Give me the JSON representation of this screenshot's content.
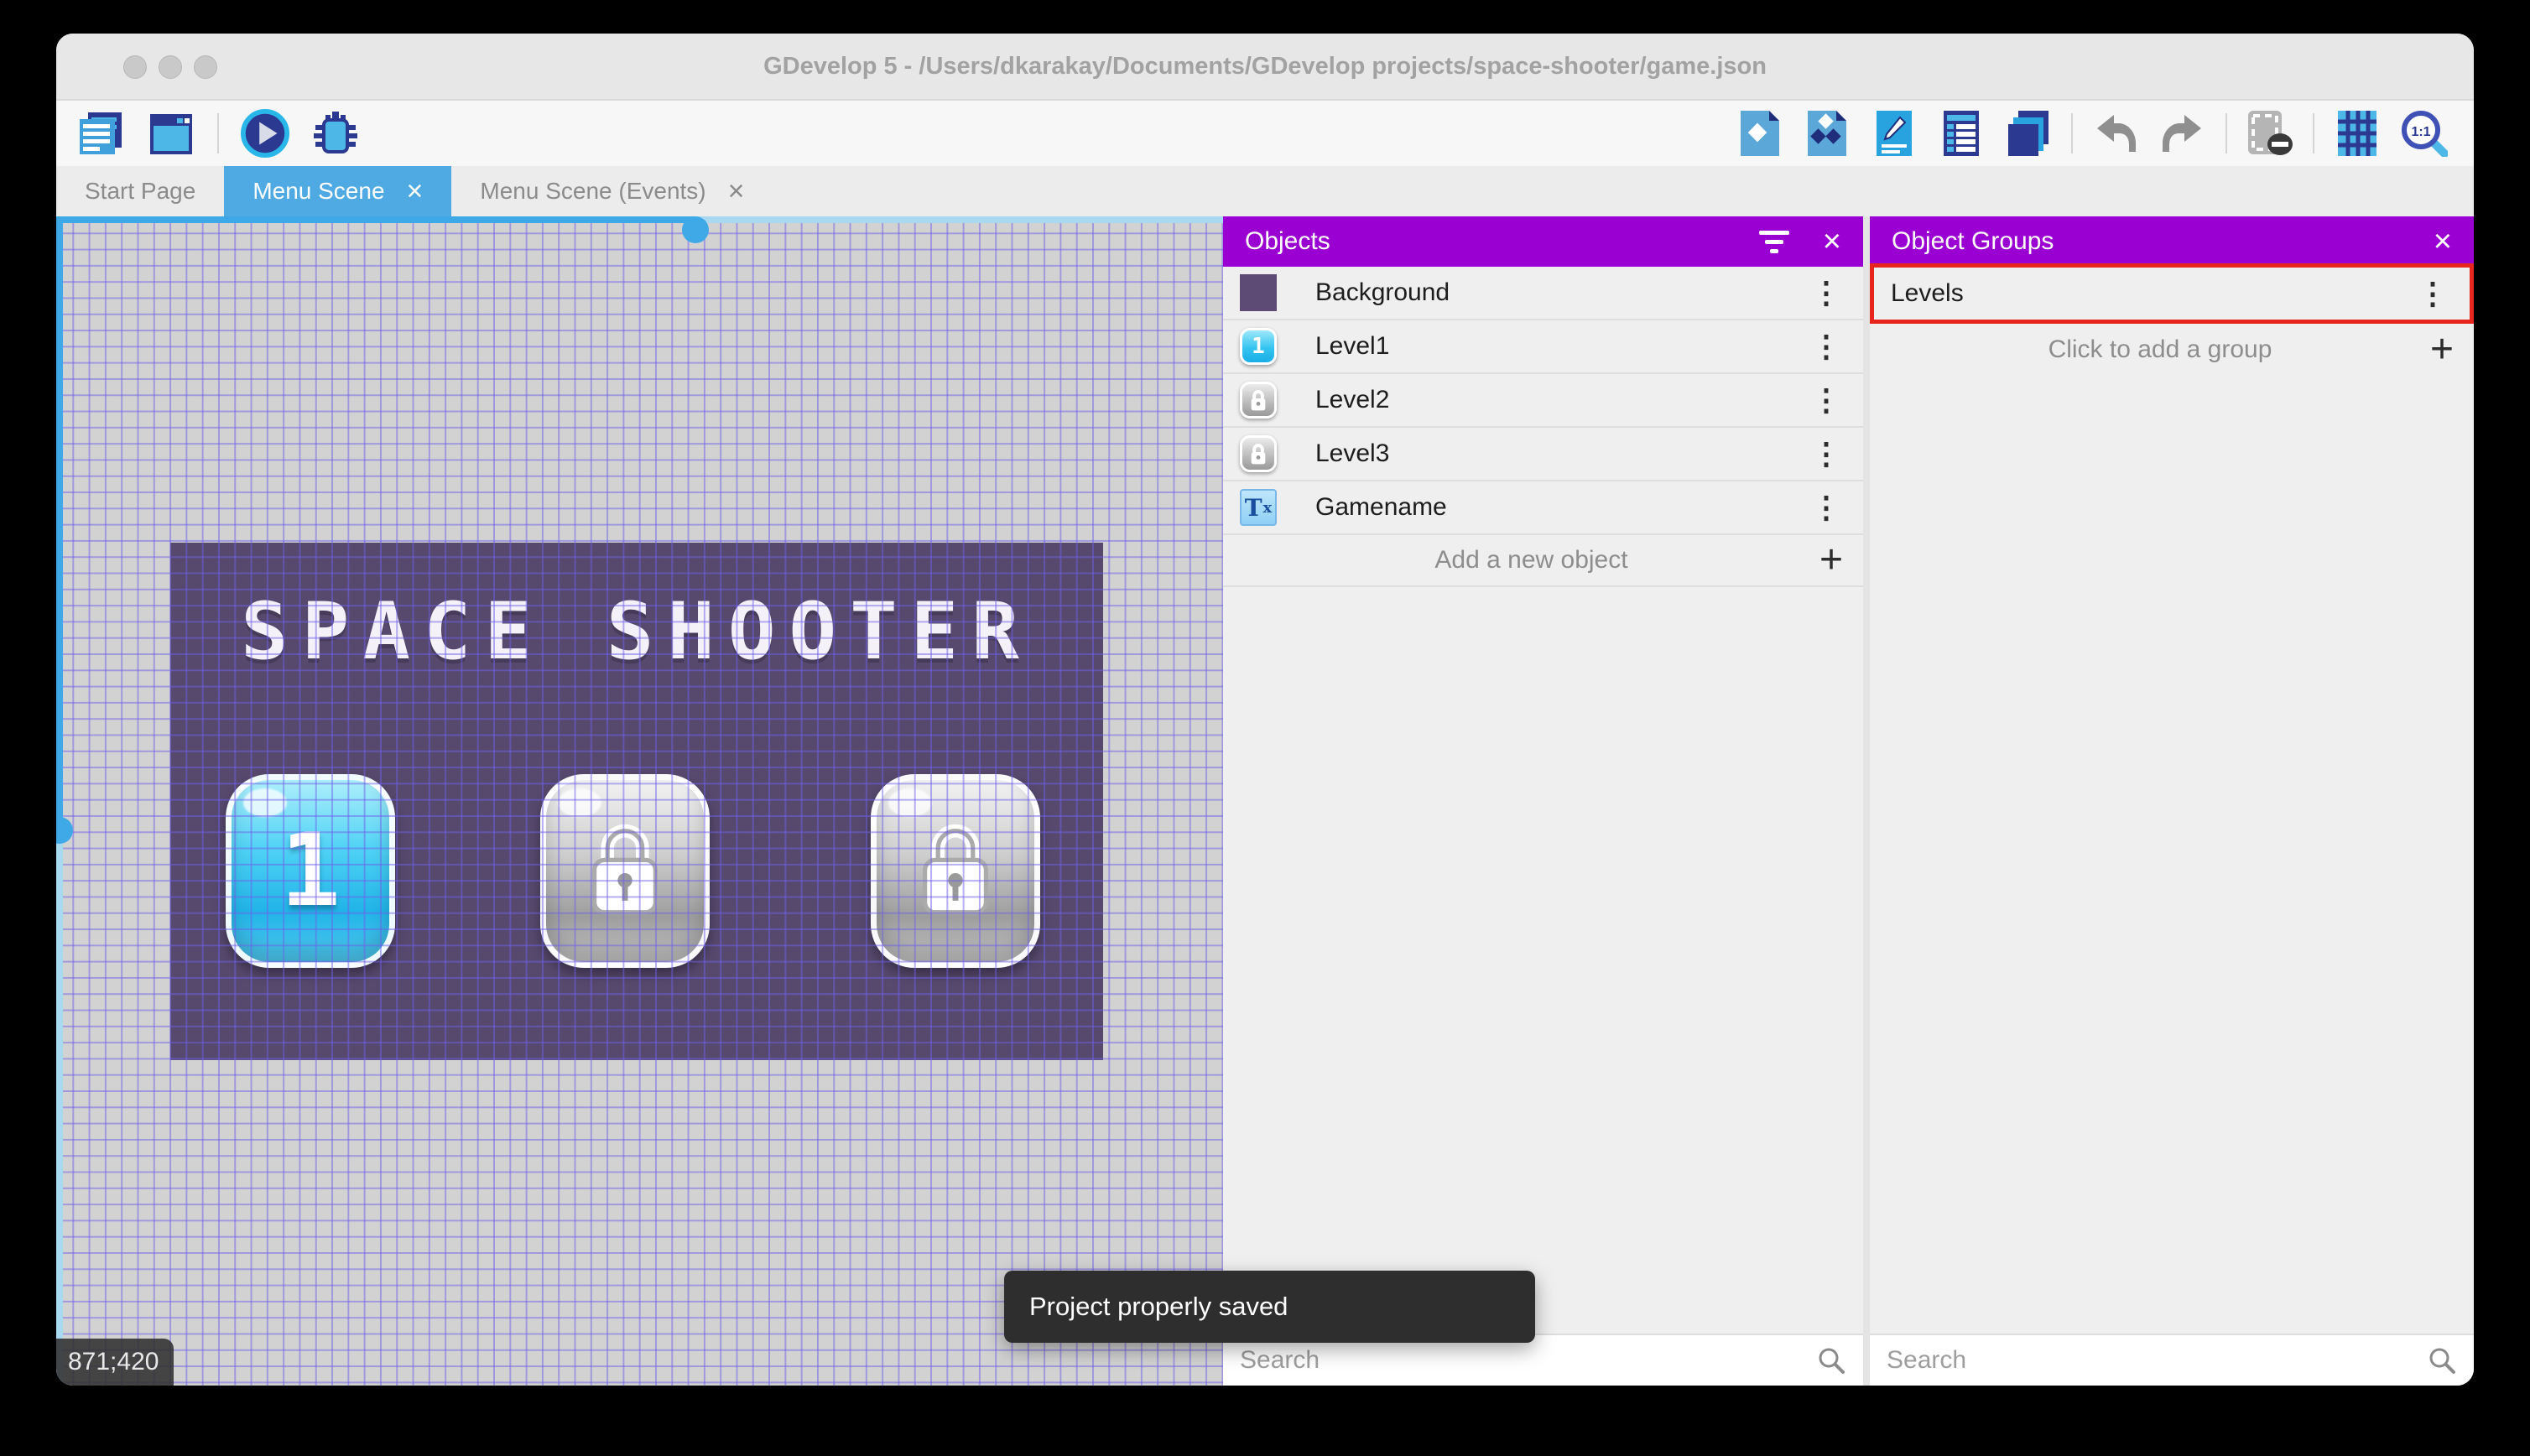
{
  "window": {
    "title": "GDevelop 5 - /Users/dkarakay/Documents/GDevelop projects/space-shooter/game.json"
  },
  "tabs": [
    {
      "label": "Start Page"
    },
    {
      "label": "Menu Scene"
    },
    {
      "label": "Menu Scene (Events)"
    }
  ],
  "toolbar": {
    "left_icons": [
      "project-manager",
      "scenes-window",
      "play",
      "debug"
    ],
    "right_icons": [
      "objects-editor",
      "object-groups-editor",
      "properties",
      "instances-list",
      "layers",
      "undo",
      "redo",
      "toggle-instances-mask",
      "grid",
      "zoom-1-1"
    ]
  },
  "canvas": {
    "scene_title": "SPACE SHOOTER",
    "level_buttons": [
      {
        "label": "1",
        "state": "unlocked"
      },
      {
        "label": "",
        "state": "locked"
      },
      {
        "label": "",
        "state": "locked"
      }
    ],
    "coordinates": "871;420",
    "toast": "Project properly saved"
  },
  "objects_panel": {
    "title": "Objects",
    "items": [
      {
        "name": "Background",
        "icon": "background-swatch"
      },
      {
        "name": "Level1",
        "icon": "level1-button"
      },
      {
        "name": "Level2",
        "icon": "locked-button"
      },
      {
        "name": "Level3",
        "icon": "locked-button"
      },
      {
        "name": "Gamename",
        "icon": "text-object"
      }
    ],
    "add_label": "Add a new object",
    "search_placeholder": "Search"
  },
  "object_groups_panel": {
    "title": "Object Groups",
    "items": [
      {
        "name": "Levels",
        "highlighted": true
      }
    ],
    "add_label": "Click to add a group",
    "search_placeholder": "Search"
  },
  "icons": {
    "close": "×",
    "kebab": "⋮",
    "plus": "+"
  },
  "colors": {
    "panel_header": "#9a00d2",
    "active_tab": "#4faae3",
    "scene_background": "#57496e",
    "canvas_background": "#d2d2d2",
    "grid_line": "#6e60e8",
    "highlight_border": "#e8251d",
    "toast_background": "#2e2e2e",
    "scrollbar": "#3fa9e8"
  }
}
